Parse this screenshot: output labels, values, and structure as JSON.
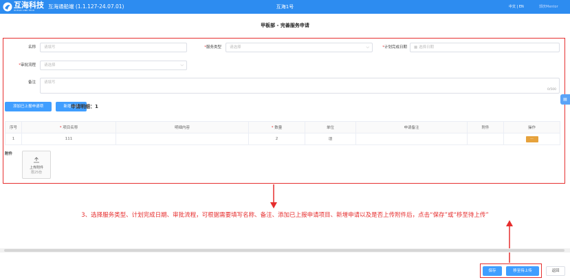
{
  "header": {
    "brand": "互海科技",
    "brand_sub": "OCEAN LINK TECH",
    "app_name": "互海通船端 (1.1.127-24.07.01)",
    "ship_name": "互海1号",
    "language": "中文 | EN",
    "user": "郭庆Mentor"
  },
  "page": {
    "title": "甲板部 - 完善服务申请"
  },
  "form": {
    "name_label": "名称",
    "name_placeholder": "请填写",
    "service_type_label": "服务类型",
    "service_type_placeholder": "请选择",
    "planned_date_label": "计划完成日期",
    "planned_date_placeholder": "选择日期",
    "approval_label": "审批流程",
    "approval_placeholder": "请选择",
    "remark_label": "备注",
    "remark_placeholder": "请填写",
    "remark_counter": "0/500"
  },
  "actions": {
    "add_reported": "添加已上报申请项",
    "new_apply": "新增申请",
    "detail_label": "申请明细：1"
  },
  "table": {
    "headers": [
      "序号",
      "项目名称",
      "明细内容",
      "数量",
      "单位",
      "申请备注",
      "附件",
      "操作"
    ],
    "rows": [
      {
        "index": "1",
        "name": "111",
        "content": "",
        "qty": "2",
        "unit": "项",
        "note": "",
        "attach": "",
        "op": "···"
      }
    ]
  },
  "attachment": {
    "label": "附件",
    "upload_label": "上传附件",
    "upload_limit": "限25份"
  },
  "instruction": "3、选择服务类型、计划完成日期、审批流程，可根据需要填写名称、备注、添加已上报申请项目、新增申请以及是否上传附件后，点击“保存”或“移至待上传”",
  "footer": {
    "save": "保存",
    "move_pending": "移至待上传",
    "back": "返回"
  },
  "colors": {
    "primary": "#409eff",
    "header": "#2d8cf0",
    "annotation": "#e62e2e",
    "op_button": "#e6a23c"
  }
}
